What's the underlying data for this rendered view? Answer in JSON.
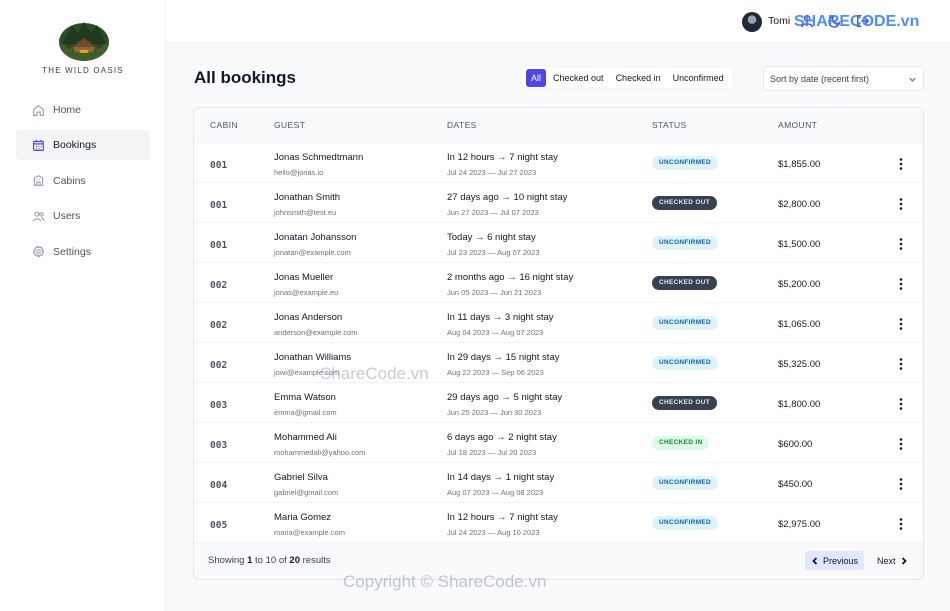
{
  "brand": {
    "name": "THE WILD OASIS"
  },
  "nav": [
    {
      "label": "Home",
      "icon": "home-icon",
      "active": false
    },
    {
      "label": "Bookings",
      "icon": "calendar-icon",
      "active": true
    },
    {
      "label": "Cabins",
      "icon": "building-icon",
      "active": false
    },
    {
      "label": "Users",
      "icon": "users-icon",
      "active": false
    },
    {
      "label": "Settings",
      "icon": "settings-icon",
      "active": false
    }
  ],
  "header": {
    "user_name": "Tomi"
  },
  "page": {
    "title": "All bookings"
  },
  "filters": {
    "options": [
      "All",
      "Checked out",
      "Checked in",
      "Unconfirmed"
    ],
    "active": "All"
  },
  "sort": {
    "value": "Sort by date (recent first)"
  },
  "table": {
    "columns": [
      "CABIN",
      "GUEST",
      "DATES",
      "STATUS",
      "AMOUNT"
    ],
    "rows": [
      {
        "cabin": "001",
        "guest_name": "Jonas Schmedtmann",
        "guest_email": "hello@jonas.io",
        "date_range": "In 12 hours → 7 night stay",
        "dates": "Jul 24 2023 — Jul 27 2023",
        "status": "UNCONFIRMED",
        "amount": "$1,855.00"
      },
      {
        "cabin": "001",
        "guest_name": "Jonathan Smith",
        "guest_email": "johnsmith@test.eu",
        "date_range": "27 days ago → 10 night stay",
        "dates": "Jun 27 2023 — Jul 07 2023",
        "status": "CHECKED OUT",
        "amount": "$2,800.00"
      },
      {
        "cabin": "001",
        "guest_name": "Jonatan Johansson",
        "guest_email": "jonatan@example.com",
        "date_range": "Today → 6 night stay",
        "dates": "Jul 23 2023 — Aug 07 2023",
        "status": "UNCONFIRMED",
        "amount": "$1,500.00"
      },
      {
        "cabin": "002",
        "guest_name": "Jonas Mueller",
        "guest_email": "jonas@example.eu",
        "date_range": "2 months ago → 16 night stay",
        "dates": "Jun 05 2023 — Jun 21 2023",
        "status": "CHECKED OUT",
        "amount": "$5,200.00"
      },
      {
        "cabin": "002",
        "guest_name": "Jonas Anderson",
        "guest_email": "anderson@example.com",
        "date_range": "In 11 days → 3 night stay",
        "dates": "Aug 04 2023 — Aug 07 2023",
        "status": "UNCONFIRMED",
        "amount": "$1,065.00"
      },
      {
        "cabin": "002",
        "guest_name": "Jonathan Williams",
        "guest_email": "jowi@example.com",
        "date_range": "In 29 days → 15 night stay",
        "dates": "Aug 22 2023 — Sep 06 2023",
        "status": "UNCONFIRMED",
        "amount": "$5,325.00"
      },
      {
        "cabin": "003",
        "guest_name": "Emma Watson",
        "guest_email": "emma@gmail.com",
        "date_range": "29 days ago → 5 night stay",
        "dates": "Jun 25 2023 — Jun 30 2023",
        "status": "CHECKED OUT",
        "amount": "$1,800.00"
      },
      {
        "cabin": "003",
        "guest_name": "Mohammed Ali",
        "guest_email": "mohammedali@yahoo.com",
        "date_range": "6 days ago → 2 night stay",
        "dates": "Jul 18 2023 — Jul 20 2023",
        "status": "CHECKED IN",
        "amount": "$600.00"
      },
      {
        "cabin": "004",
        "guest_name": "Gabriel Silva",
        "guest_email": "gabriel@gmail.com",
        "date_range": "In 14 days → 1 night stay",
        "dates": "Aug 07 2023 — Aug 08 2023",
        "status": "UNCONFIRMED",
        "amount": "$450.00"
      },
      {
        "cabin": "005",
        "guest_name": "Maria Gomez",
        "guest_email": "maria@example.com",
        "date_range": "In 12 hours → 7 night stay",
        "dates": "Jul 24 2023 — Aug 10 2023",
        "status": "UNCONFIRMED",
        "amount": "$2,975.00"
      }
    ]
  },
  "pagination": {
    "prefix": "Showing",
    "from": "1",
    "to_word": "to",
    "to": "10",
    "of_word": "of",
    "total": "20",
    "suffix": "results",
    "previous": "Previous",
    "next": "Next"
  },
  "watermarks": {
    "top": "SHARECODE.vn",
    "middle": "ShareCode.vn",
    "bottom": "Copyright © ShareCode.vn"
  },
  "colors": {
    "accent": "#4f46e5",
    "unconfirmed_bg": "#e0f2fe",
    "unconfirmed_text": "#0369a1",
    "checked_out_bg": "#374151",
    "checked_in_bg": "#dcfce7",
    "checked_in_text": "#15803d"
  }
}
